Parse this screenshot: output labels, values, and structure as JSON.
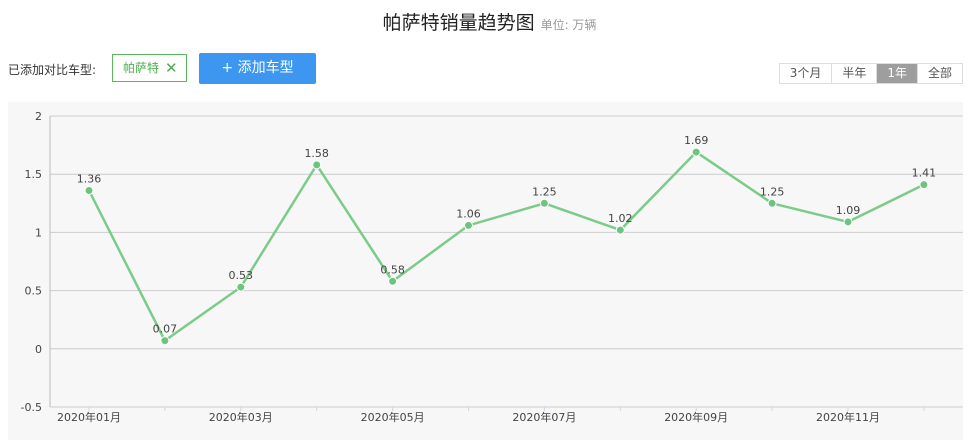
{
  "header": {
    "title": "帕萨特销量趋势图",
    "unit": "单位: 万辆"
  },
  "compare": {
    "label": "已添加对比车型:",
    "chip_label": "帕萨特",
    "chip_close": "✕",
    "add_button": "+ 添加车型"
  },
  "range_options": [
    {
      "label": "3个月",
      "active": false
    },
    {
      "label": "半年",
      "active": false
    },
    {
      "label": "1年",
      "active": true
    },
    {
      "label": "全部",
      "active": false
    }
  ],
  "colors": {
    "line": "#7ccb8b",
    "point": "#6cc480",
    "accent": "#3d97f0",
    "grid": "#cccccc"
  },
  "chart_data": {
    "type": "line",
    "x": [
      "2020年01月",
      "2020年02月",
      "2020年03月",
      "2020年04月",
      "2020年05月",
      "2020年06月",
      "2020年07月",
      "2020年08月",
      "2020年09月",
      "2020年10月",
      "2020年11月",
      "2020年12月"
    ],
    "x_tick_labels": [
      "2020年01月",
      "2020年03月",
      "2020年05月",
      "2020年07月",
      "2020年09月",
      "2020年11月"
    ],
    "series": [
      {
        "values": [
          1.36,
          0.07,
          0.53,
          1.58,
          0.58,
          1.06,
          1.25,
          1.02,
          1.69,
          1.25,
          1.09,
          1.41
        ]
      }
    ],
    "value_labels": [
      "1.36",
      "0.07",
      "0.53",
      "1.58",
      "0.58",
      "1.06",
      "1.25",
      "1.02",
      "1.69",
      "1.25",
      "1.09",
      "1.41"
    ],
    "y_ticks": [
      "2",
      "1.5",
      "1",
      "0.5",
      "0",
      "-0.5"
    ],
    "ylim": [
      -0.5,
      2
    ],
    "grid": true,
    "legend": "none"
  }
}
